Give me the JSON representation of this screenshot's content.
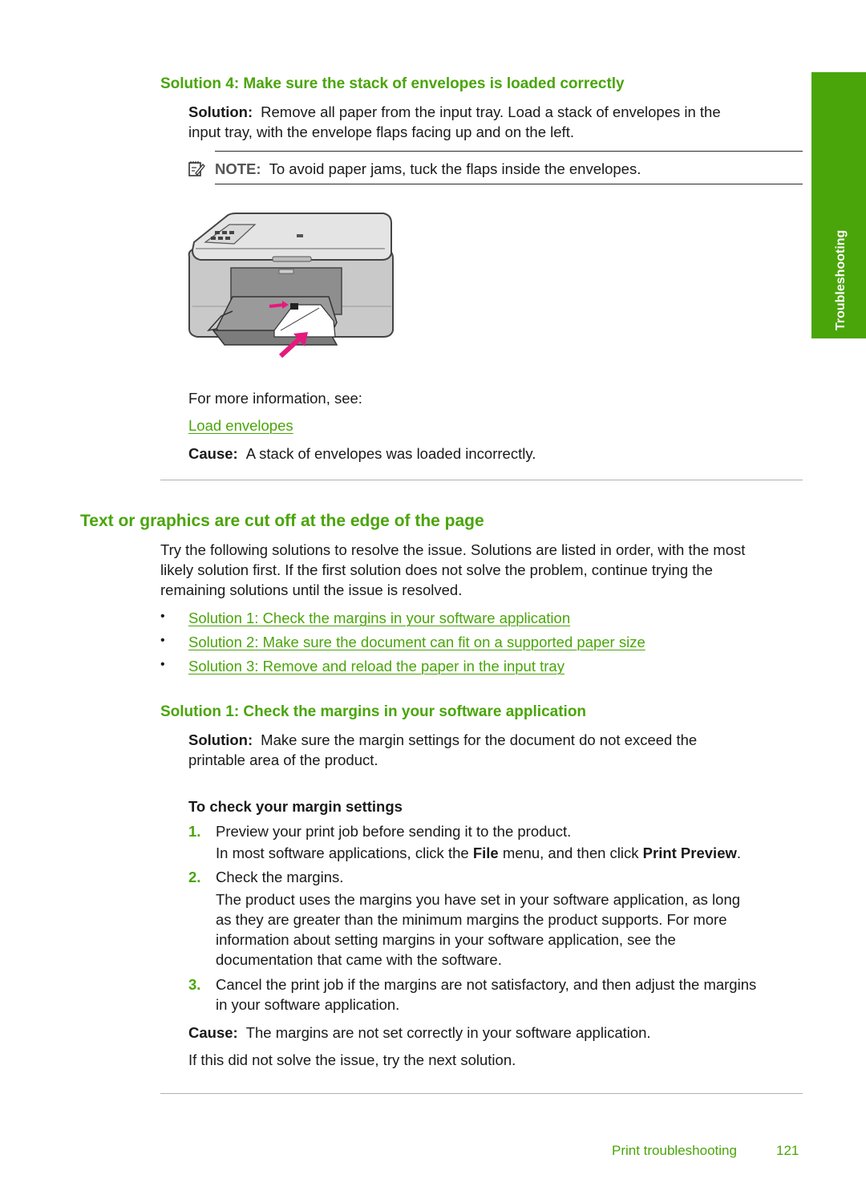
{
  "side_tab": {
    "label": "Troubleshooting"
  },
  "solution4": {
    "heading": "Solution 4: Make sure the stack of envelopes is loaded correctly",
    "solution_label": "Solution:",
    "solution_line1": "Remove all paper from the input tray. Load a stack of envelopes in the",
    "solution_line2": "input tray, with the envelope flaps facing up and on the left.",
    "note_label": "NOTE:",
    "note_text": "To avoid paper jams, tuck the flaps inside the envelopes.",
    "figure_alt": "Printer with envelopes loaded in input tray",
    "more_info": "For more information, see:",
    "link": "Load envelopes",
    "cause_label": "Cause:",
    "cause_text": "A stack of envelopes was loaded incorrectly."
  },
  "section": {
    "heading": "Text or graphics are cut off at the edge of the page",
    "intro_line1": "Try the following solutions to resolve the issue. Solutions are listed in order, with the most",
    "intro_line2": "likely solution first. If the first solution does not solve the problem, continue trying the",
    "intro_line3": "remaining solutions until the issue is resolved.",
    "bullet_char": "•",
    "links": [
      "Solution 1: Check the margins in your software application",
      "Solution 2: Make sure the document can fit on a supported paper size",
      "Solution 3: Remove and reload the paper in the input tray"
    ]
  },
  "solution1": {
    "heading": "Solution 1: Check the margins in your software application",
    "solution_label": "Solution:",
    "solution_line1": "Make sure the margin settings for the document do not exceed the",
    "solution_line2": "printable area of the product.",
    "procedure_title": "To check your margin settings",
    "steps": [
      {
        "num": "1.",
        "text": "Preview your print job before sending it to the product.",
        "detail_pre": "In most software applications, click the ",
        "detail_b1": "File",
        "detail_mid": " menu, and then click ",
        "detail_b2": "Print Preview",
        "detail_post": "."
      },
      {
        "num": "2.",
        "text": "Check the margins.",
        "detail_line1": "The product uses the margins you have set in your software application, as long",
        "detail_line2": "as they are greater than the minimum margins the product supports. For more",
        "detail_line3": "information about setting margins in your software application, see the",
        "detail_line4": "documentation that came with the software."
      },
      {
        "num": "3.",
        "text_line1": "Cancel the print job if the margins are not satisfactory, and then adjust the margins",
        "text_line2": "in your software application."
      }
    ],
    "cause_label": "Cause:",
    "cause_text": "The margins are not set correctly in your software application.",
    "next": "If this did not solve the issue, try the next solution."
  },
  "footer": {
    "section": "Print troubleshooting",
    "page": "121"
  }
}
